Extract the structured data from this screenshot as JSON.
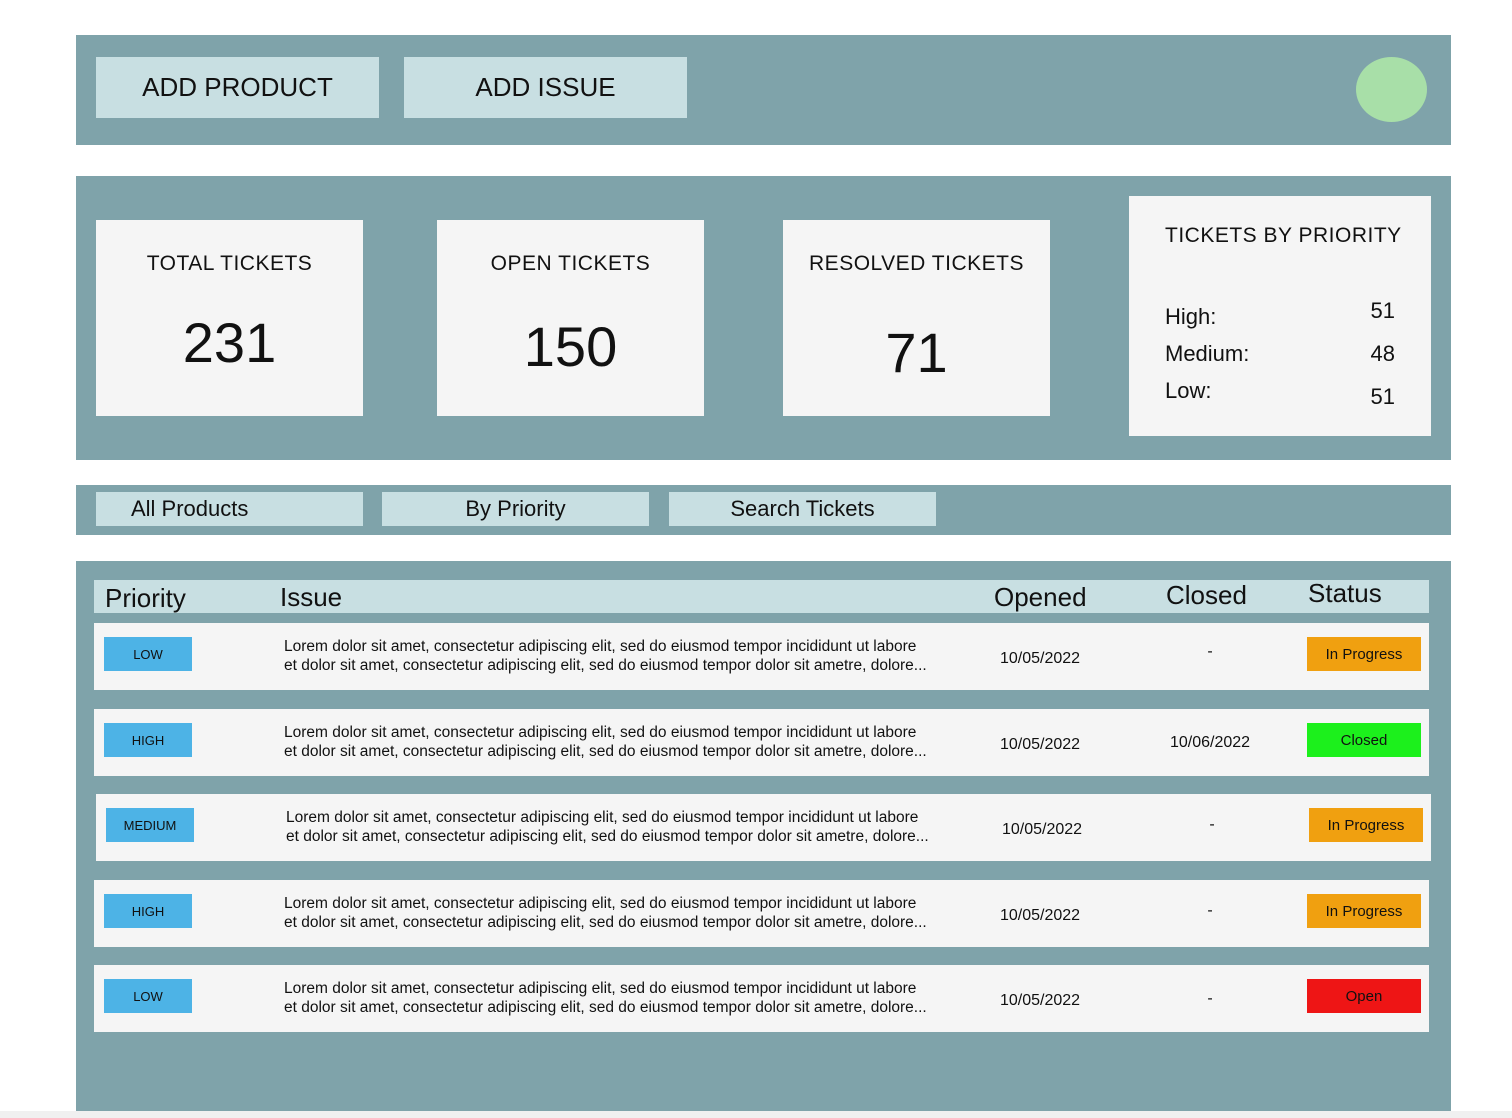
{
  "topbar": {
    "add_product_label": "ADD PRODUCT",
    "add_issue_label": "ADD ISSUE"
  },
  "stats": {
    "total": {
      "label": "TOTAL TICKETS",
      "value": "231"
    },
    "open": {
      "label": "OPEN TICKETS",
      "value": "150"
    },
    "resolved": {
      "label": "RESOLVED TICKETS",
      "value": "71"
    },
    "by_priority": {
      "title": "TICKETS BY PRIORITY",
      "rows": [
        {
          "label": "High:",
          "value": "51"
        },
        {
          "label": "Medium:",
          "value": "48"
        },
        {
          "label": "Low:",
          "value": "51"
        }
      ]
    }
  },
  "tabs": {
    "all_products": "All Products",
    "by_priority": "By Priority",
    "search_tickets": "Search Tickets"
  },
  "table": {
    "headers": {
      "priority": "Priority",
      "issue": "Issue",
      "opened": "Opened",
      "closed": "Closed",
      "status": "Status"
    },
    "rows": [
      {
        "priority": "LOW",
        "issue_line1": "Lorem dolor sit amet, consectetur adipiscing elit, sed do eiusmod tempor incididunt ut labore",
        "issue_line2": "et dolor sit amet, consectetur adipiscing elit, sed do eiusmod tempor dolor sit ametre, dolore...",
        "opened": "10/05/2022",
        "closed": "-",
        "status": "In Progress"
      },
      {
        "priority": "HIGH",
        "issue_line1": "Lorem dolor sit amet, consectetur adipiscing elit, sed do eiusmod tempor incididunt ut labore",
        "issue_line2": "et dolor sit amet, consectetur adipiscing elit, sed do eiusmod tempor dolor sit ametre, dolore...",
        "opened": "10/05/2022",
        "closed": "10/06/2022",
        "status": "Closed"
      },
      {
        "priority": "MEDIUM",
        "issue_line1": "Lorem dolor sit amet, consectetur adipiscing elit, sed do eiusmod tempor incididunt ut labore",
        "issue_line2": "et dolor sit amet, consectetur adipiscing elit, sed do eiusmod tempor dolor sit ametre, dolore...",
        "opened": "10/05/2022",
        "closed": "-",
        "status": "In Progress"
      },
      {
        "priority": "HIGH",
        "issue_line1": "Lorem dolor sit amet, consectetur adipiscing elit, sed do eiusmod tempor incididunt ut labore",
        "issue_line2": "et dolor sit amet, consectetur adipiscing elit, sed do eiusmod tempor dolor sit ametre, dolore...",
        "opened": "10/05/2022",
        "closed": "-",
        "status": "In Progress"
      },
      {
        "priority": "LOW",
        "issue_line1": "Lorem dolor sit amet, consectetur adipiscing elit, sed do eiusmod tempor incididunt ut labore",
        "issue_line2": "et dolor sit amet, consectetur adipiscing elit, sed do eiusmod tempor dolor sit ametre, dolore...",
        "opened": "10/05/2022",
        "closed": "-",
        "status": "Open"
      }
    ]
  },
  "colors": {
    "panel": "#7fa3aa",
    "light_button": "#c8dfe2",
    "card": "#f5f5f5",
    "avatar": "#a8dfa8",
    "priority_badge": "#4db3e6",
    "status_in_progress": "#f0a010",
    "status_closed": "#1cf01c",
    "status_open": "#ee1515"
  }
}
